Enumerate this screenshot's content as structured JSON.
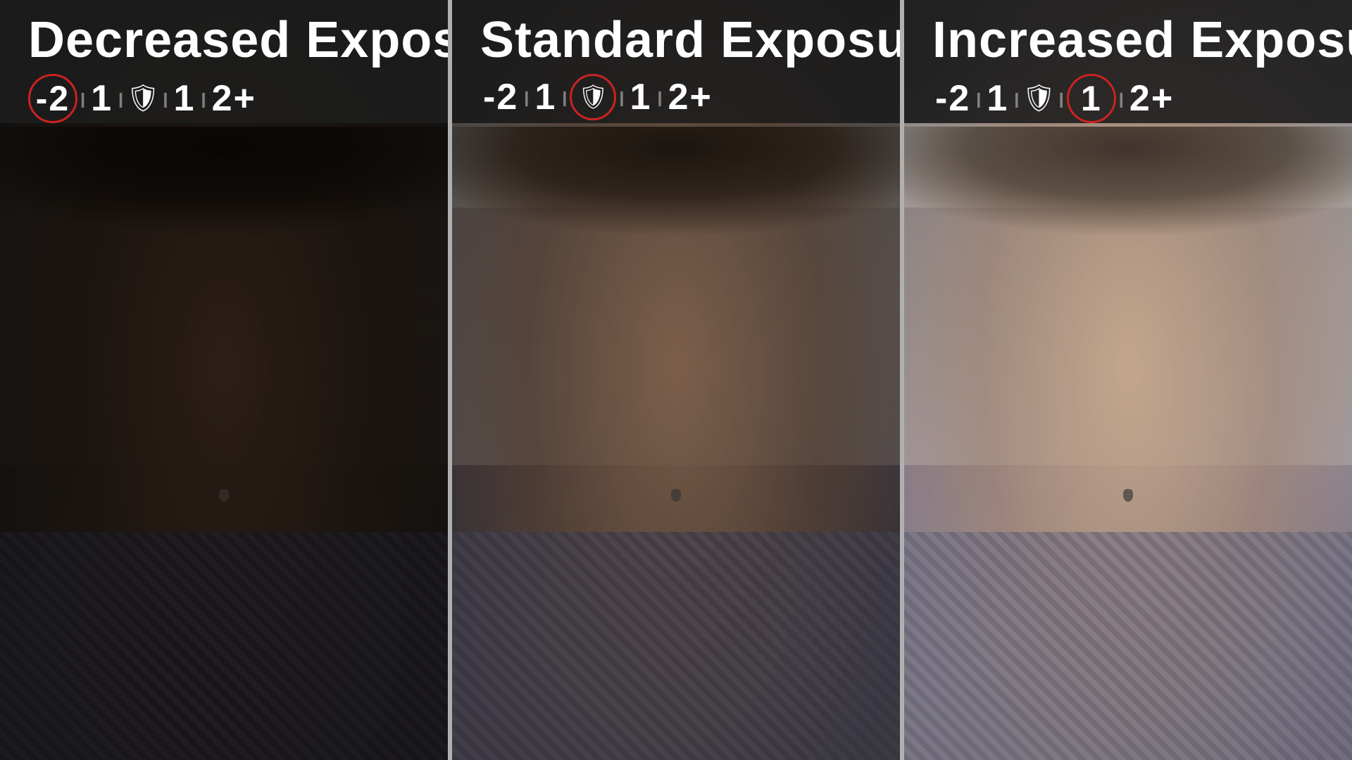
{
  "panels": [
    {
      "id": "decreased",
      "title": "Decreased Exposure",
      "scale": {
        "items": [
          {
            "value": "-2",
            "highlighted": true,
            "type": "text"
          },
          {
            "value": "div",
            "type": "divider"
          },
          {
            "value": "1",
            "highlighted": false,
            "type": "text"
          },
          {
            "value": "div",
            "type": "divider"
          },
          {
            "value": "shield",
            "highlighted": false,
            "type": "shield"
          },
          {
            "value": "div",
            "type": "divider"
          },
          {
            "value": "1",
            "highlighted": false,
            "type": "text"
          },
          {
            "value": "div",
            "type": "divider"
          },
          {
            "value": "2+",
            "highlighted": false,
            "type": "text"
          }
        ]
      }
    },
    {
      "id": "standard",
      "title": "Standard Exposure",
      "scale": {
        "items": [
          {
            "value": "-2",
            "highlighted": false,
            "type": "text"
          },
          {
            "value": "div",
            "type": "divider"
          },
          {
            "value": "1",
            "highlighted": false,
            "type": "text"
          },
          {
            "value": "div",
            "type": "divider"
          },
          {
            "value": "shield",
            "highlighted": true,
            "type": "shield"
          },
          {
            "value": "div",
            "type": "divider"
          },
          {
            "value": "1",
            "highlighted": false,
            "type": "text"
          },
          {
            "value": "div",
            "type": "divider"
          },
          {
            "value": "2+",
            "highlighted": false,
            "type": "text"
          }
        ]
      }
    },
    {
      "id": "increased",
      "title": "Increased Exposure",
      "scale": {
        "items": [
          {
            "value": "-2",
            "highlighted": false,
            "type": "text"
          },
          {
            "value": "div",
            "type": "divider"
          },
          {
            "value": "1",
            "highlighted": false,
            "type": "text"
          },
          {
            "value": "div",
            "type": "divider"
          },
          {
            "value": "shield",
            "highlighted": false,
            "type": "shield"
          },
          {
            "value": "div",
            "type": "divider"
          },
          {
            "value": "1",
            "highlighted": true,
            "type": "text"
          },
          {
            "value": "div",
            "type": "divider"
          },
          {
            "value": "2+",
            "highlighted": false,
            "type": "text"
          }
        ]
      }
    }
  ]
}
